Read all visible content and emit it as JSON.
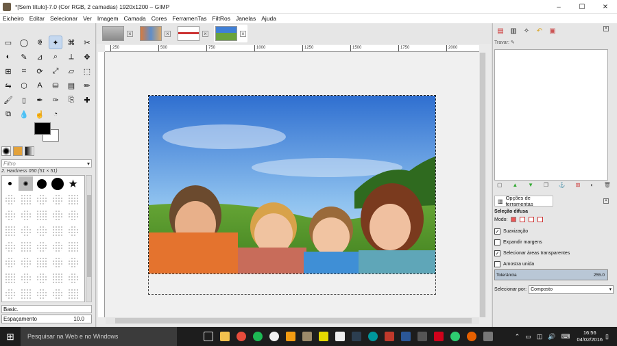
{
  "window": {
    "title": "*[Sem título]-7.0 (Cor RGB, 2 camadas) 1920x1200 – GIMP",
    "controls": [
      "minimize",
      "maximize",
      "close"
    ]
  },
  "menu": [
    "Eicheiro",
    "Editar",
    "Selecionar",
    "Ver",
    "Imagem",
    "Camada",
    "Cores",
    "FerramenTas",
    "FiltRos",
    "Janelas",
    "Ajuda"
  ],
  "toolbox": {
    "tools": [
      "rect-select",
      "ellipse-select",
      "free-select",
      "fuzzy-select",
      "color-select",
      "scissors",
      "foreground-select",
      "paths",
      "color-picker",
      "zoom",
      "measure",
      "move",
      "align",
      "crop",
      "rotate",
      "scale",
      "shear",
      "perspective",
      "flip",
      "cage",
      "text",
      "bucket-fill",
      "blend",
      "pencil",
      "paintbrush",
      "eraser",
      "airbrush",
      "ink",
      "clone",
      "heal",
      "perspective-clone",
      "blur",
      "smudge",
      "dodge"
    ],
    "selected_tool_index": 3,
    "filter_placeholder": "Filtro",
    "brush_name": "2. Hardness 050 (51 × 51)",
    "brush_preset": "Basic.",
    "spacing_label": "Espaçamento",
    "spacing_value": "10.0"
  },
  "image_tabs": [
    {
      "name": "image-1",
      "active": false
    },
    {
      "name": "image-2",
      "active": false
    },
    {
      "name": "image-3",
      "active": false
    },
    {
      "name": "image-4",
      "active": true
    }
  ],
  "ruler_ticks": [
    "250",
    "500",
    "750",
    "1000",
    "1250",
    "1500",
    "1750",
    "2000"
  ],
  "layers_dock": {
    "lock_label": "Travar:",
    "buttons": [
      "new-layer",
      "raise-layer",
      "lower-layer",
      "duplicate-layer",
      "anchor-layer",
      "merge-layer",
      "mask-layer",
      "delete-layer"
    ]
  },
  "tool_options": {
    "tab_label": "Opções de ferramentas",
    "section_title": "Seleção difusa",
    "mode_label": "Modo:",
    "feather_label": "Suavização",
    "feather_checked": true,
    "expand_label": "Expandir margens",
    "expand_checked": false,
    "transparent_label": "Selecionar áreas transparentes",
    "transparent_checked": true,
    "sample_merged_label": "Amostra unida",
    "sample_merged_checked": false,
    "threshold_label": "Tolerância",
    "threshold_value": "255.0",
    "select_by_label": "Selecionar por:",
    "select_by_value": "Composto"
  },
  "taskbar": {
    "search_placeholder": "Pesquisar na Web e no Windows",
    "time": "16:56",
    "date": "04/02/2016"
  }
}
